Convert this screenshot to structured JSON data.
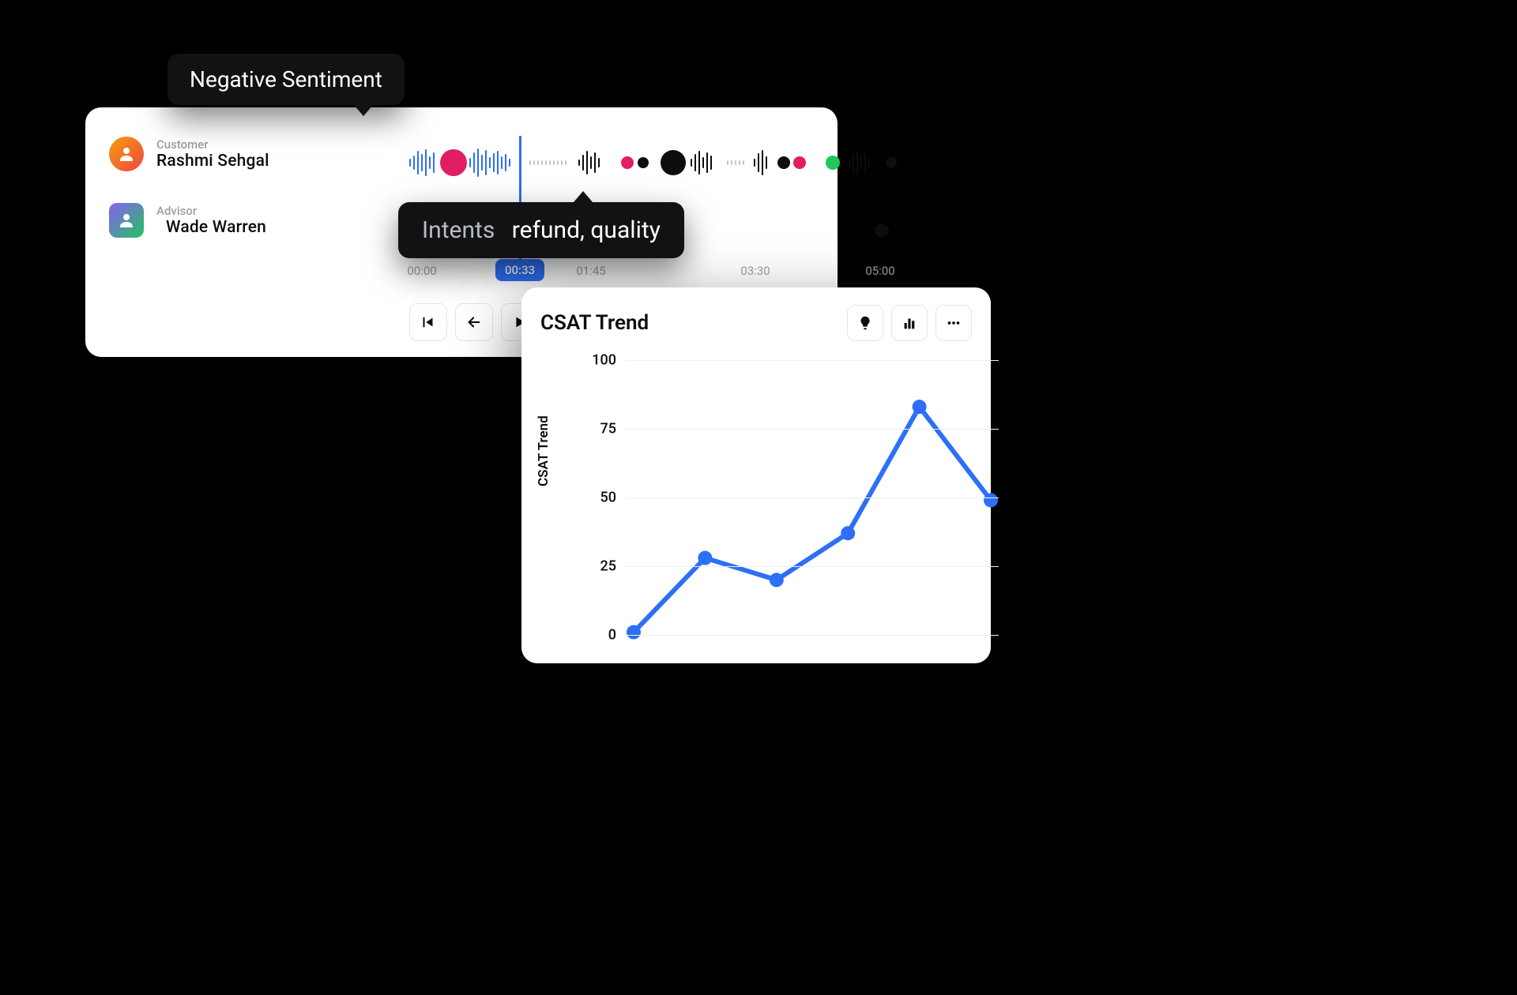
{
  "tooltips": {
    "sentiment": "Negative Sentiment",
    "intents_label": "Intents",
    "intents_value": "refund, quality"
  },
  "participants": {
    "customer": {
      "role": "Customer",
      "name": "Rashmi Sehgal"
    },
    "advisor": {
      "role": "Advisor",
      "name": "Wade Warren"
    }
  },
  "timeline": {
    "ticks": [
      "00:00",
      "01:45",
      "03:30",
      "05:00"
    ],
    "current": "00:33"
  },
  "controls": [
    "skip-start",
    "prev",
    "play",
    "next"
  ],
  "colors": {
    "accent": "#2d6ff7",
    "negative": "#e11d64",
    "positive": "#22c55e",
    "neutral": "#0c0d0e"
  },
  "chart": {
    "title": "CSAT Trend",
    "y_title": "CSAT Trend"
  },
  "chart_data": {
    "type": "line",
    "title": "CSAT Trend",
    "xlabel": "",
    "ylabel": "CSAT Trend",
    "ylim": [
      0,
      100
    ],
    "y_ticks": [
      0,
      25,
      50,
      75,
      100
    ],
    "x": [
      1,
      2,
      3,
      4,
      5,
      6
    ],
    "values": [
      1,
      28,
      20,
      37,
      83,
      49
    ]
  }
}
